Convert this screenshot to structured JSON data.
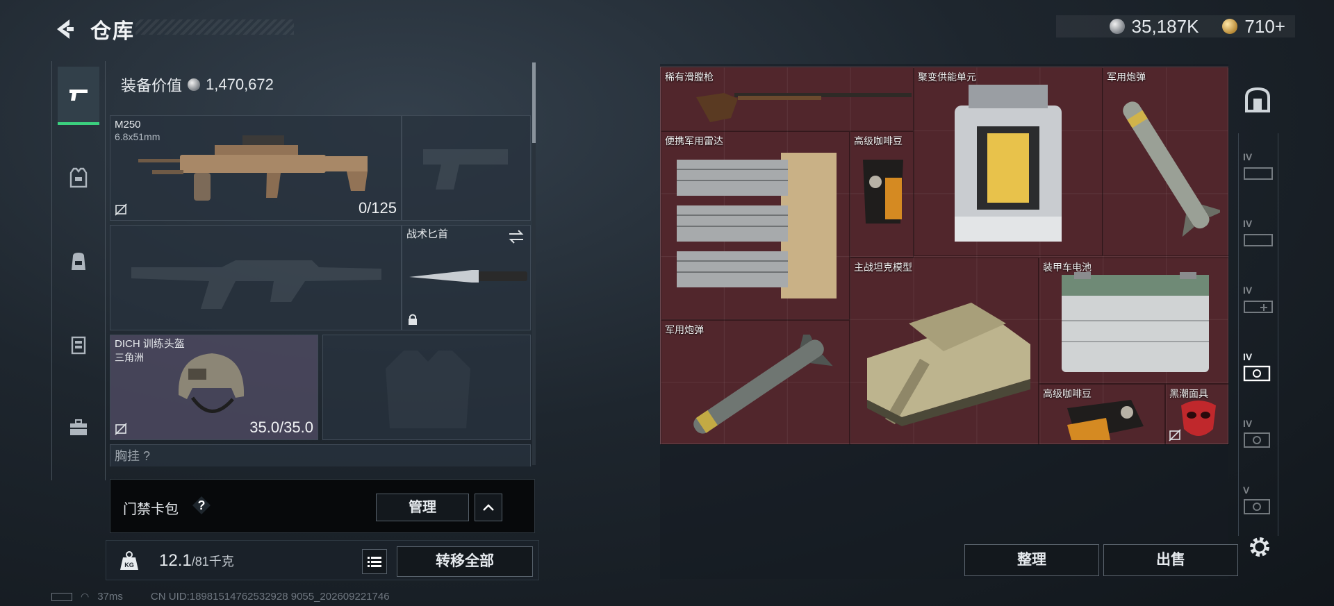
{
  "header": {
    "title": "仓库",
    "currencies": [
      {
        "value": "35,187K",
        "icon": "silver-coin-icon"
      },
      {
        "value": "710+",
        "icon": "gold-coin-icon"
      }
    ]
  },
  "loadout": {
    "value_label": "装备价值",
    "value": "1,470,672",
    "primary": {
      "name": "M250",
      "caliber": "6.8x51mm",
      "ammo": "0/125"
    },
    "melee": {
      "name": "战术匕首"
    },
    "helmet": {
      "name": "DICH 训练头盔",
      "sub": "三角洲",
      "durability": "35.0/35.0"
    },
    "chest_label": "胸挂 ?"
  },
  "keycard": {
    "title": "门禁卡包",
    "help": "?",
    "manage_label": "管理"
  },
  "weight": {
    "current": "12.1",
    "max": "/81千克",
    "transfer_label": "转移全部"
  },
  "warehouse": {
    "items": [
      {
        "label": "稀有滑膛枪"
      },
      {
        "label": "聚变供能单元"
      },
      {
        "label": "军用炮弹"
      },
      {
        "label": "便携军用雷达"
      },
      {
        "label": "高级咖啡豆"
      },
      {
        "label": "主战坦克模型"
      },
      {
        "label": "装甲车电池"
      },
      {
        "label": "军用炮弹"
      },
      {
        "label": "高级咖啡豆"
      },
      {
        "label": "黑潮面具"
      }
    ],
    "sort_label": "整理",
    "sell_label": "出售"
  },
  "right_rail": {
    "tiers": [
      "IV",
      "IV",
      "IV",
      "IV",
      "IV",
      "V"
    ]
  },
  "footer": {
    "ping": "37ms",
    "uid": "CN UID:18981514762532928 9055_202609221746"
  },
  "colors": {
    "accent_green": "#3bd07e",
    "grid_bg": "#51262c",
    "panel": "#1a2129"
  }
}
